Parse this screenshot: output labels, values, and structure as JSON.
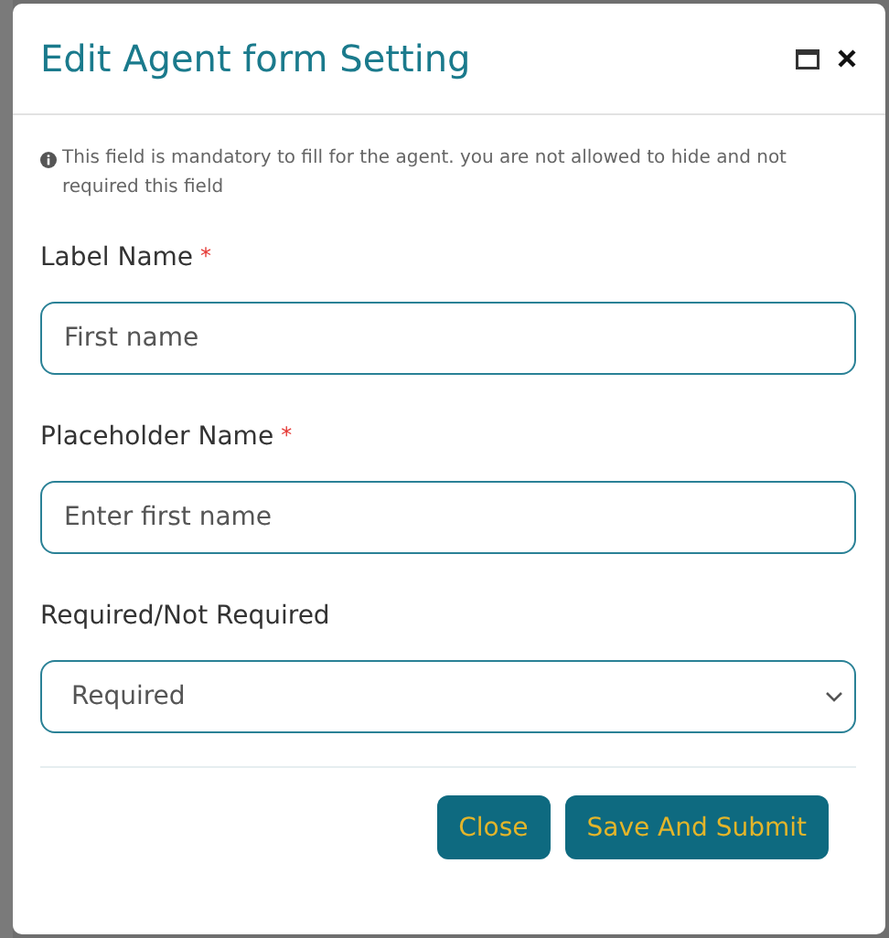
{
  "dialog": {
    "title": "Edit Agent form Setting",
    "notice": "This field is mandatory to fill for the agent. you are not allowed to hide and not required this field",
    "fields": [
      {
        "kind": "text",
        "label": "Label Name",
        "required_mark": "*",
        "value": "First name"
      },
      {
        "kind": "text",
        "label": "Placeholder Name",
        "required_mark": "*",
        "value": "Enter first name"
      },
      {
        "kind": "select",
        "label": "Required/Not Required",
        "value": "Required"
      }
    ],
    "buttons": [
      {
        "label": "Close"
      },
      {
        "label": "Save And Submit"
      }
    ]
  }
}
